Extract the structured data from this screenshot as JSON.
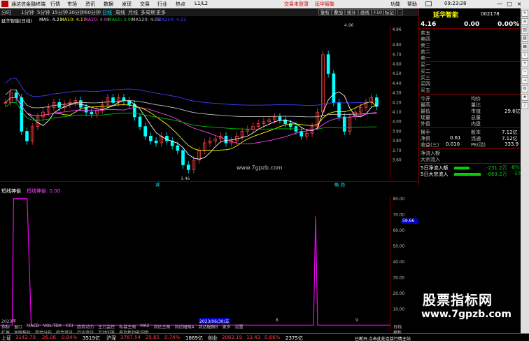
{
  "titlebar": {
    "app_title": "通达信金融终端",
    "menu": [
      "行情",
      "市场",
      "资讯",
      "数据",
      "发现",
      "交易",
      "行业",
      "热点",
      "L1/L2"
    ],
    "ad_text": "交易未登录",
    "stock_short": "延华智能",
    "right_menu": [
      "功能",
      "帮助"
    ],
    "clock": "09:23:28",
    "win_buttons": [
      "—",
      "□",
      "×"
    ]
  },
  "toolbar": {
    "periods": [
      "分时",
      "1分钟",
      "5分钟",
      "15分钟",
      "30分钟",
      "60分钟",
      "日线",
      "周线",
      "月线",
      "多周期",
      "更多"
    ],
    "active_period": "日线",
    "right_buttons": [
      "复权",
      "叠加",
      "统计",
      "画线",
      "F10",
      "标记",
      "-"
    ]
  },
  "chart_header": {
    "name": "延华智能(日线)",
    "ma5": "MA5: 4.21",
    "ma10": "MA10: 4.17",
    "ma20": "MA20: 4.09",
    "ma60": "MA60: 3.90",
    "ma120": "MA120: 4.05",
    "ma250": "MA250: 4.21"
  },
  "price_axis": [
    "4.96",
    "4.80",
    "4.70",
    "4.60",
    "4.50",
    "4.40",
    "4.30",
    "4.20",
    "4.10",
    "4.00",
    "3.90",
    "3.80",
    "3.70",
    "3.60"
  ],
  "price_marks": {
    "high": "4.96",
    "low": "3.46"
  },
  "chart_markers": [
    "减",
    "融",
    "趋"
  ],
  "watermark_center": "www.7gpzb.com",
  "sub_header": {
    "name": "短线神偷",
    "indicator": "短线神偷: 0.00"
  },
  "sub_axis": [
    "80.00",
    "70.00",
    "60.00",
    "50.00",
    "40.00",
    "30.00",
    "20.00",
    "10.00"
  ],
  "sub_current": "59.66",
  "date_axis": {
    "start": "2023年",
    "mid": "2023/06/30/五",
    "m1": "8",
    "m2": "9"
  },
  "tabs_row1": [
    "指标",
    "窗口",
    "MACD",
    "VOL-TDX",
    "CCI",
    "趋势动力",
    "主力监控",
    "私募主图",
    "MA2",
    "到达主图",
    "到达幅图A",
    "到达幅图B",
    "更多",
    "设置"
  ],
  "tabs_row2": [
    "扩展",
    "关联报价",
    "资金分布",
    "综合资讯",
    "行业资讯",
    "互动问答",
    "普及新功能说明"
  ],
  "tabs_right": [
    "日线",
    "横板"
  ],
  "right_panel": {
    "code": "002178",
    "name": "延华智能",
    "price": "4.16",
    "change": "0.00",
    "change_pct": "0.00%",
    "asks": [
      "卖五",
      "卖四",
      "卖三",
      "卖二",
      "卖一"
    ],
    "bids": [
      "买一",
      "买二",
      "买三",
      "买四",
      "买五"
    ],
    "quote_left": [
      "今开",
      "最高",
      "最低",
      "现量",
      "外盘"
    ],
    "quote_right_label": [
      "均价",
      "量比",
      "市值",
      "总量",
      "内盘"
    ],
    "market_cap": "29.6亿",
    "turnover_label": "换手",
    "equity_label": "股本",
    "equity_val": "7.12亿",
    "nav_label": "净资",
    "nav_val": "0.61",
    "float_label": "流通",
    "float_val": "7.12亿",
    "eps_label": "收益(三)",
    "eps_val": "0.010",
    "pe_label": "PE(动)",
    "pe_val": "333.9",
    "flow_labels": [
      "净流入额",
      "大宗流入"
    ],
    "flow5_label": "5日净流入额",
    "flow5_val": "-231.2万",
    "flow5_pct": "-8%",
    "big5_label": "5日大宗流入",
    "big5_val": "-669.2万",
    "big5_pct": "-1%"
  },
  "statusbar": {
    "sh_label": "上证",
    "sh_val": "3142.70",
    "sh_chg": "26.06",
    "sh_pct": "0.84%",
    "sh_amt": "3519亿",
    "sz_label": "沪深",
    "sz_val": "3767.54",
    "sz_chg": "25.65",
    "sz_pct": "0.74%",
    "sz_amt": "1869亿",
    "cy_label": "创业",
    "cy_val": "2063.19",
    "cy_chg": "13.43",
    "cy_pct": "0.66%",
    "cy_amt": "2375亿",
    "right_text": "已断开,点击此处连接行情主站"
  },
  "watermark": {
    "line1": "股票指标网",
    "line2": "www.7gpzb.com"
  },
  "chart_data": {
    "type": "line",
    "title": "延华智能(日线)",
    "ylim": [
      3.46,
      4.96
    ],
    "candles_close": [
      4.2,
      4.3,
      4.25,
      3.9,
      3.8,
      3.95,
      4.05,
      4.1,
      4.15,
      4.2,
      4.15,
      4.18,
      4.2,
      4.22,
      4.15,
      4.1,
      4.08,
      4.12,
      4.18,
      4.25,
      4.2,
      4.25,
      4.22,
      4.18,
      4.05,
      3.95,
      3.85,
      3.8,
      3.78,
      3.85,
      3.8,
      3.75,
      3.7,
      3.55,
      3.5,
      3.6,
      3.7,
      3.78,
      3.8,
      3.82,
      3.85,
      3.78,
      3.8,
      3.85,
      3.9,
      3.92,
      3.95,
      3.98,
      4.0,
      4.02,
      4.05,
      4.02,
      3.98,
      3.95,
      3.9,
      3.85,
      3.88,
      3.95,
      4.1,
      4.7,
      4.5,
      4.2,
      4.05,
      3.9,
      4.05,
      4.1,
      4.15,
      4.2,
      4.25,
      4.16
    ],
    "sub_series": {
      "name": "短线神偷",
      "peaks": [
        80,
        80,
        80
      ]
    }
  }
}
